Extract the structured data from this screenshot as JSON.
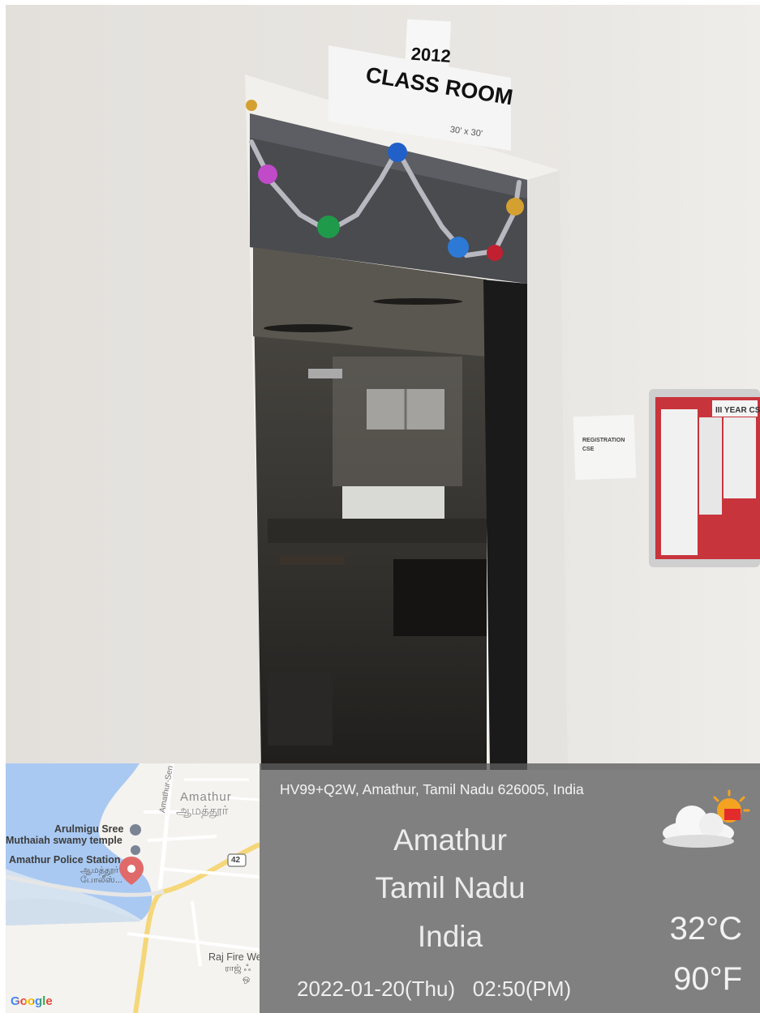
{
  "sign": {
    "room_number": "2012",
    "room_label": "CLASS ROOM",
    "room_size": "30' x 30'"
  },
  "wall_notices": {
    "notice_text": "REGISTRATION\nCSE",
    "board_header": "III YEAR CSE"
  },
  "map": {
    "labels": {
      "town_en": "Amathur",
      "town_ta": "ஆமத்தூர்",
      "temple_line1": "Arulmigu Sree",
      "temple_line2": "Muthaiah swamy temple",
      "police_en": "Amathur Police Station",
      "police_ta_1": "ஆமத்தூர்",
      "police_ta_2": "போலீஸ்...",
      "road_side": "Amathur-Sen",
      "route_shield": "42",
      "fire": "Raj Fire We",
      "fire_ta_1": "ராஜ் ஃ",
      "fire_ta_2": "ஒ"
    },
    "attribution": "Google",
    "colors": {
      "water": "#a9c9f2",
      "land": "#f4f3ef",
      "road_major": "#f5d77a",
      "road_minor": "#ffffff",
      "pin": "#e06a6a"
    }
  },
  "info": {
    "address": "HV99+Q2W, Amathur, Tamil Nadu 626005, India",
    "city": "Amathur",
    "state": "Tamil Nadu",
    "country": "India",
    "datetime": "2022-01-20(Thu)   02:50(PM)",
    "temp_c": "32°C",
    "temp_f": "90°F",
    "weather_icon": "partly-cloudy-sun-icon"
  }
}
